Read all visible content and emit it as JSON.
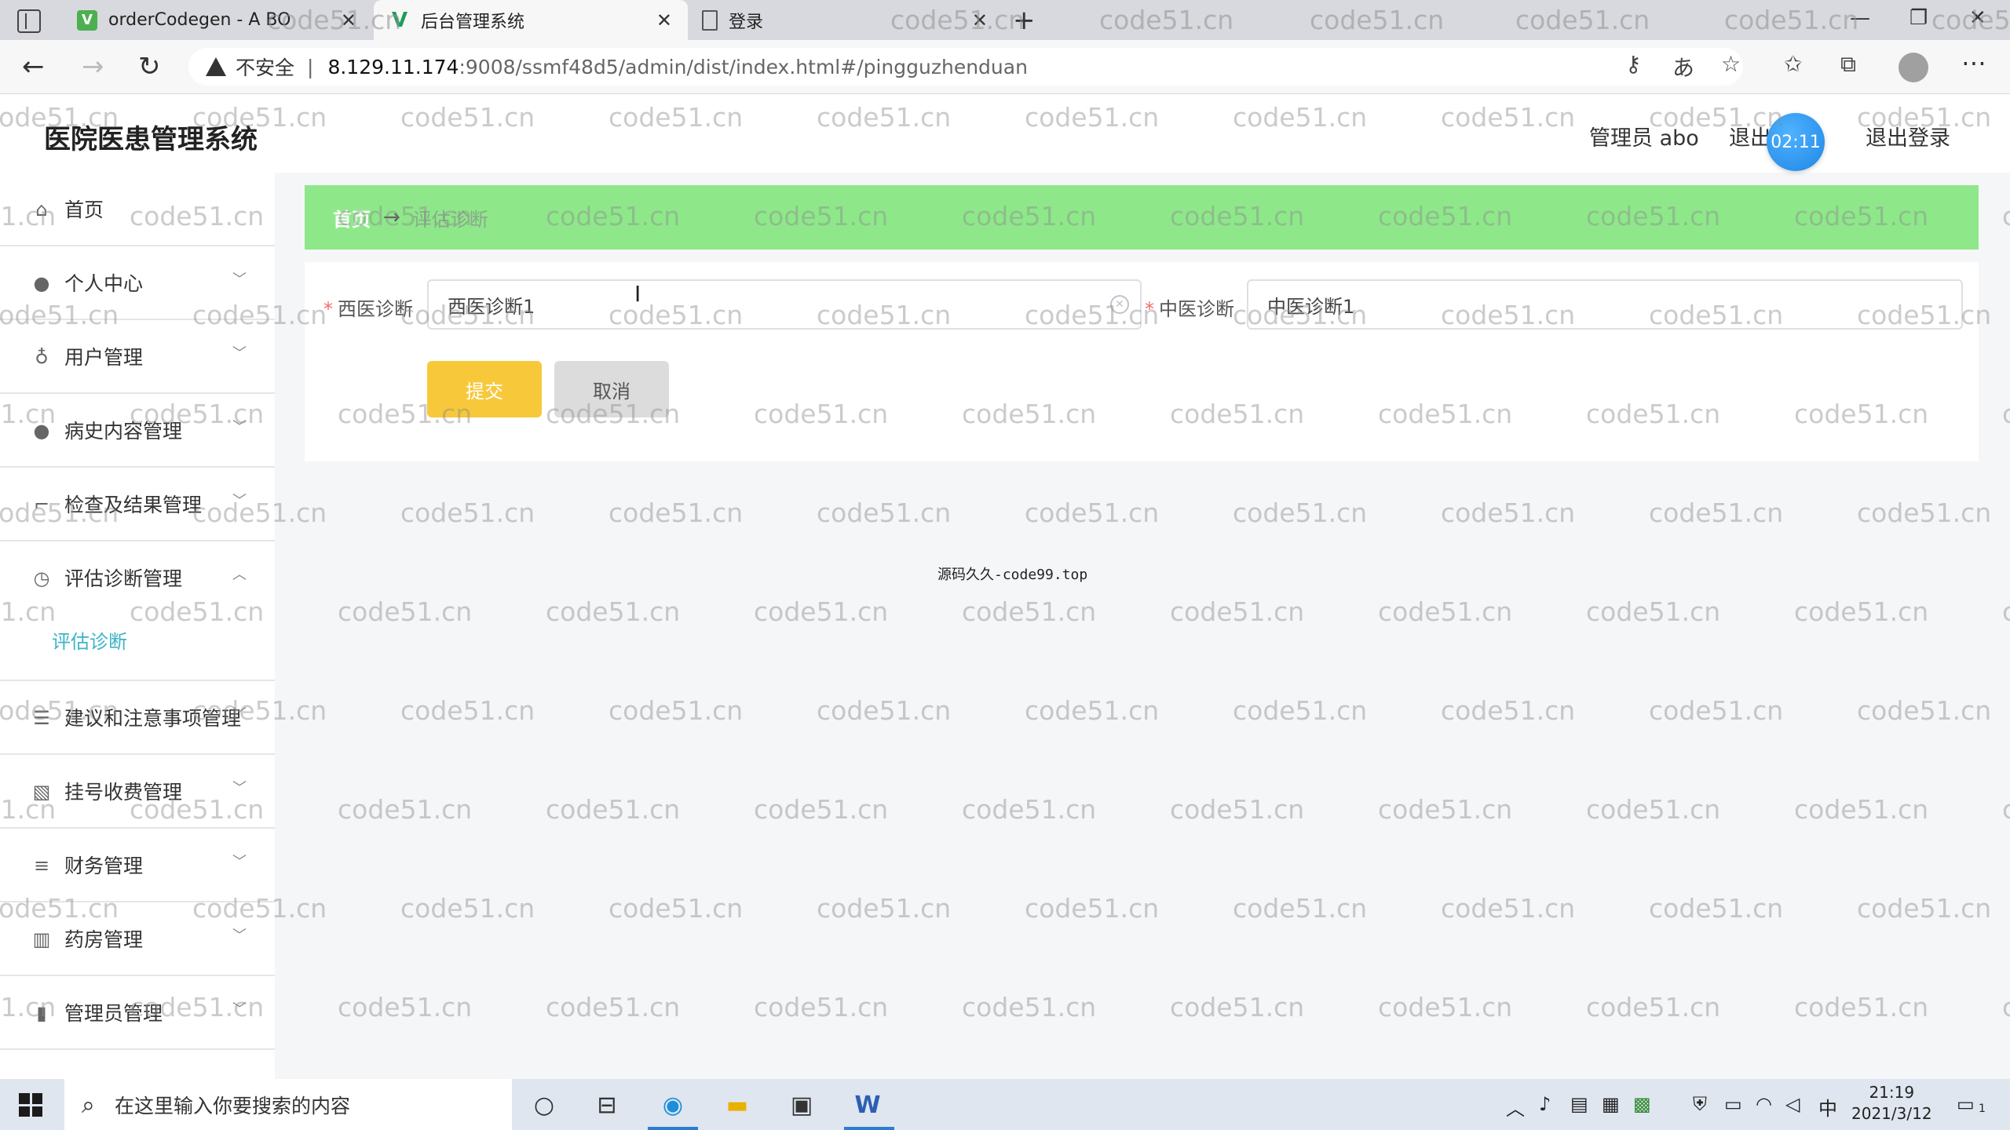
{
  "browser": {
    "tabs": [
      {
        "title": "orderCodegen - A BO",
        "favicon": "v-logo-icon"
      },
      {
        "title": "后台管理系统",
        "favicon": "vue-logo-icon"
      },
      {
        "title": "登录",
        "favicon": "page-icon"
      }
    ],
    "address": {
      "insecure_label": "不安全",
      "separator": "|",
      "host": "8.129.11.174",
      "path": ":9008/ssmf48d5/admin/dist/index.html#/pingguzhenduan"
    }
  },
  "header": {
    "title": "医院医患管理系统",
    "user_label": "管理员 abo",
    "logout_partial": "退出",
    "logout_label": "退出登录",
    "timer": "02:11"
  },
  "sidebar": {
    "items": [
      {
        "label": "首页",
        "icon": "home-icon"
      },
      {
        "label": "个人中心",
        "icon": "user-icon"
      },
      {
        "label": "用户管理",
        "icon": "mic-icon"
      },
      {
        "label": "病史内容管理",
        "icon": "user-icon"
      },
      {
        "label": "检查及结果管理",
        "icon": "crop-icon"
      },
      {
        "label": "评估诊断管理",
        "icon": "clock-icon"
      },
      {
        "label": "建议和注意事项管理",
        "icon": "stack-icon"
      },
      {
        "label": "挂号收费管理",
        "icon": "chart-icon"
      },
      {
        "label": "财务管理",
        "icon": "list-icon"
      },
      {
        "label": "药房管理",
        "icon": "books-icon"
      },
      {
        "label": "管理员管理",
        "icon": "bar-chart-icon"
      }
    ],
    "active_sub": "评估诊断"
  },
  "breadcrumb": {
    "home": "首页",
    "separator": "→",
    "current": "评估诊断"
  },
  "form": {
    "western_label": "西医诊断",
    "western_value": "西医诊断1",
    "chinese_label": "中医诊断",
    "chinese_value": "中医诊断1",
    "required_mark": "*",
    "submit_label": "提交",
    "cancel_label": "取消"
  },
  "footer_note": "源码久久-code99.top",
  "watermark_text": "code51.cn",
  "taskbar": {
    "search_placeholder": "在这里输入你要搜索的内容",
    "ime": "中",
    "time": "21:19",
    "date": "2021/3/12",
    "notification_count": "1"
  },
  "colors": {
    "breadcrumb_bg": "#8ee88a",
    "submit_bg": "#f7c83a",
    "active_sub": "#3cb4c5",
    "timer_bg": "#1f86e5"
  }
}
